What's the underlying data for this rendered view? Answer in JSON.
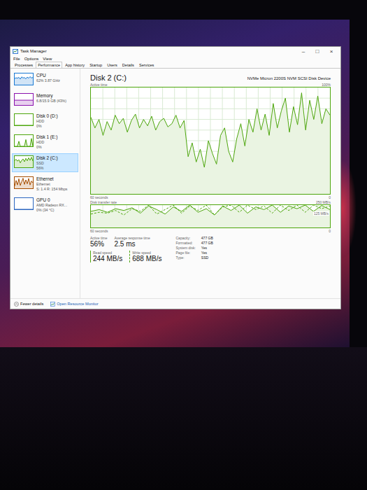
{
  "window": {
    "title": "Task Manager",
    "controls": [
      "–",
      "□",
      "×"
    ]
  },
  "menu": [
    "File",
    "Options",
    "View"
  ],
  "tabs": [
    {
      "label": "Processes",
      "selected": false
    },
    {
      "label": "Performance",
      "selected": true
    },
    {
      "label": "App history",
      "selected": false
    },
    {
      "label": "Startup",
      "selected": false
    },
    {
      "label": "Users",
      "selected": false
    },
    {
      "label": "Details",
      "selected": false
    },
    {
      "label": "Services",
      "selected": false
    }
  ],
  "sidebar": {
    "items": [
      {
        "name": "CPU",
        "lines": [
          "62% 3.87 GHz"
        ],
        "selected": false,
        "color": "#1a7ad4",
        "graph": [
          55,
          62,
          58,
          66,
          50,
          70,
          60,
          64,
          52,
          68,
          58,
          72,
          60,
          65
        ]
      },
      {
        "name": "Memory",
        "lines": [
          "6.8/15.9 GB (43%)"
        ],
        "selected": false,
        "color": "#8b12ae",
        "graph": [
          43,
          43,
          43,
          43,
          43,
          43,
          43,
          43,
          43,
          43,
          43,
          43,
          43,
          43
        ]
      },
      {
        "name": "Disk 0 (D:)",
        "lines": [
          "HDD",
          "0%"
        ],
        "selected": false,
        "color": "#4da60c",
        "graph": [
          0,
          0,
          0,
          0,
          0,
          0,
          0,
          0,
          0,
          0,
          0,
          0,
          0,
          0
        ]
      },
      {
        "name": "Disk 1 (E:)",
        "lines": [
          "HDD",
          "0%"
        ],
        "selected": false,
        "color": "#4da60c",
        "graph": [
          0,
          0,
          0,
          45,
          0,
          0,
          0,
          0,
          60,
          0,
          0,
          0,
          70,
          0
        ]
      },
      {
        "name": "Disk 2 (C:)",
        "lines": [
          "SSD",
          "56%"
        ],
        "selected": true,
        "color": "#4da60c",
        "graph": [
          60,
          72,
          55,
          68,
          40,
          62,
          75,
          50,
          80,
          58,
          85,
          62,
          90,
          56
        ]
      },
      {
        "name": "Ethernet",
        "lines": [
          "Ethernet",
          "S: 1.4 R: 154 Mbps"
        ],
        "selected": false,
        "color": "#a74f01",
        "graph": [
          20,
          70,
          30,
          85,
          25,
          60,
          90,
          35,
          75,
          40,
          88,
          30,
          65,
          50
        ]
      },
      {
        "name": "GPU 0",
        "lines": [
          "AMD Radeon RX...",
          "0% (34 °C)"
        ],
        "selected": false,
        "color": "#2b66c0",
        "graph": [
          0,
          0,
          0,
          0,
          0,
          0,
          0,
          0,
          0,
          0,
          0,
          0,
          0,
          0
        ]
      }
    ]
  },
  "panel": {
    "title": "Disk 2 (C:)",
    "device": "NVMe Micron 2200S NVM SCSI Disk Device",
    "active_chart": {
      "label": "Active time",
      "max": "100%",
      "time": "60 seconds",
      "min": "0",
      "values": [
        72,
        62,
        70,
        55,
        68,
        60,
        74,
        66,
        71,
        58,
        69,
        75,
        62,
        70,
        64,
        73,
        60,
        68,
        71,
        63,
        66,
        74,
        62,
        69,
        35,
        48,
        30,
        42,
        25,
        50,
        38,
        28,
        55,
        62,
        40,
        30,
        52,
        66,
        45,
        70,
        58,
        80,
        60,
        75,
        55,
        85,
        62,
        78,
        90,
        58,
        82,
        65,
        95,
        60,
        88,
        70,
        92,
        66,
        80,
        74
      ]
    },
    "transfer_chart": {
      "label": "Disk transfer rate",
      "max": "250 MB/s",
      "mid": "125 MB/s",
      "time": "60 seconds",
      "min": "0",
      "scale": 250,
      "read": [
        180,
        200,
        170,
        210,
        190,
        220,
        160,
        240,
        200,
        150,
        230,
        180,
        250,
        170,
        210,
        140,
        240,
        190,
        250,
        160,
        230,
        200,
        250,
        170,
        240,
        210,
        250,
        180,
        245,
        200
      ],
      "write": [
        150,
        170,
        160,
        190,
        140,
        210,
        180,
        250,
        150,
        200,
        250,
        160,
        240,
        190,
        250,
        140,
        230,
        250,
        170,
        250,
        200,
        240,
        160,
        250,
        190,
        250,
        170,
        250,
        210,
        240
      ]
    },
    "stats": [
      {
        "label": "Active time",
        "value": "56%"
      },
      {
        "label": "Average response time",
        "value": "2.5 ms"
      }
    ],
    "speeds": [
      {
        "label": "Read speed",
        "value": "244 MB/s",
        "kind": "read"
      },
      {
        "label": "Write speed",
        "value": "688 MB/s",
        "kind": "write"
      }
    ],
    "details": [
      {
        "label": "Capacity:",
        "value": "477 GB"
      },
      {
        "label": "Formatted:",
        "value": "477 GB"
      },
      {
        "label": "System disk:",
        "value": "Yes"
      },
      {
        "label": "Page file:",
        "value": "Yes"
      },
      {
        "label": "Type:",
        "value": "SSD"
      }
    ]
  },
  "footer": {
    "fewer": "Fewer details",
    "monitor": "Open Resource Monitor"
  }
}
